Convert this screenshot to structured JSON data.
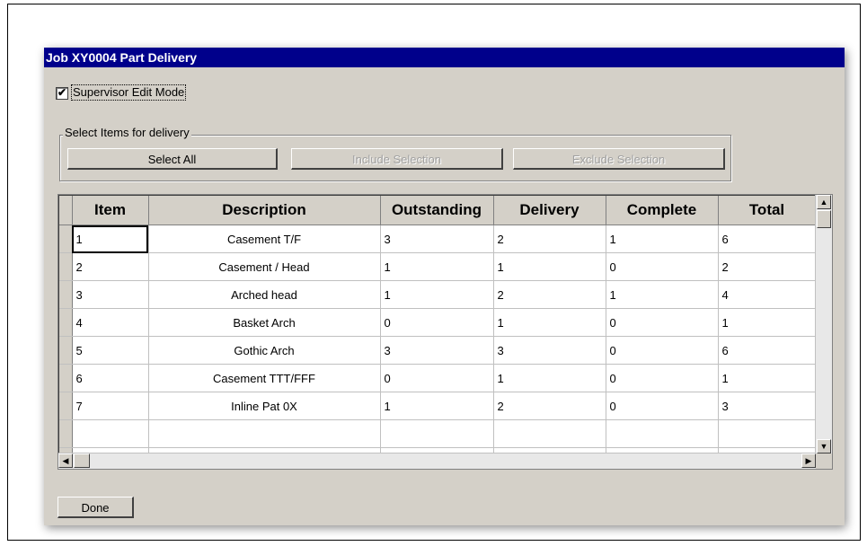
{
  "window": {
    "title": "Job XY0004 Part Delivery"
  },
  "supervisor": {
    "checked": true,
    "check_mark": "✔",
    "label": "Supervisor Edit Mode"
  },
  "group": {
    "label": "Select Items for delivery"
  },
  "buttons": {
    "select_all": "Select All",
    "include_selection": "Include Selection",
    "exclude_selection": "Exclude Selection",
    "done": "Done"
  },
  "table": {
    "headers": [
      "Item",
      "Description",
      "Outstanding",
      "Delivery",
      "Complete",
      "Total"
    ],
    "rows": [
      [
        "1",
        "Casement T/F",
        "3",
        "2",
        "1",
        "6"
      ],
      [
        "2",
        "Casement / Head",
        "1",
        "1",
        "0",
        "2"
      ],
      [
        "3",
        "Arched head",
        "1",
        "2",
        "1",
        "4"
      ],
      [
        "4",
        "Basket Arch",
        "0",
        "1",
        "0",
        "1"
      ],
      [
        "5",
        "Gothic Arch",
        "3",
        "3",
        "0",
        "6"
      ],
      [
        "6",
        "Casement TTT/FFF",
        "0",
        "1",
        "0",
        "1"
      ],
      [
        "7",
        "Inline Pat 0X",
        "1",
        "2",
        "0",
        "3"
      ]
    ]
  },
  "icons": {
    "checkbox": "check-icon",
    "scroll_up": "scroll-up-arrow-icon",
    "scroll_down": "scroll-down-arrow-icon",
    "scroll_left": "scroll-left-arrow-icon",
    "scroll_right": "scroll-right-arrow-icon"
  },
  "colors": {
    "titlebar": "#00008b",
    "face": "#d4d0c8"
  }
}
